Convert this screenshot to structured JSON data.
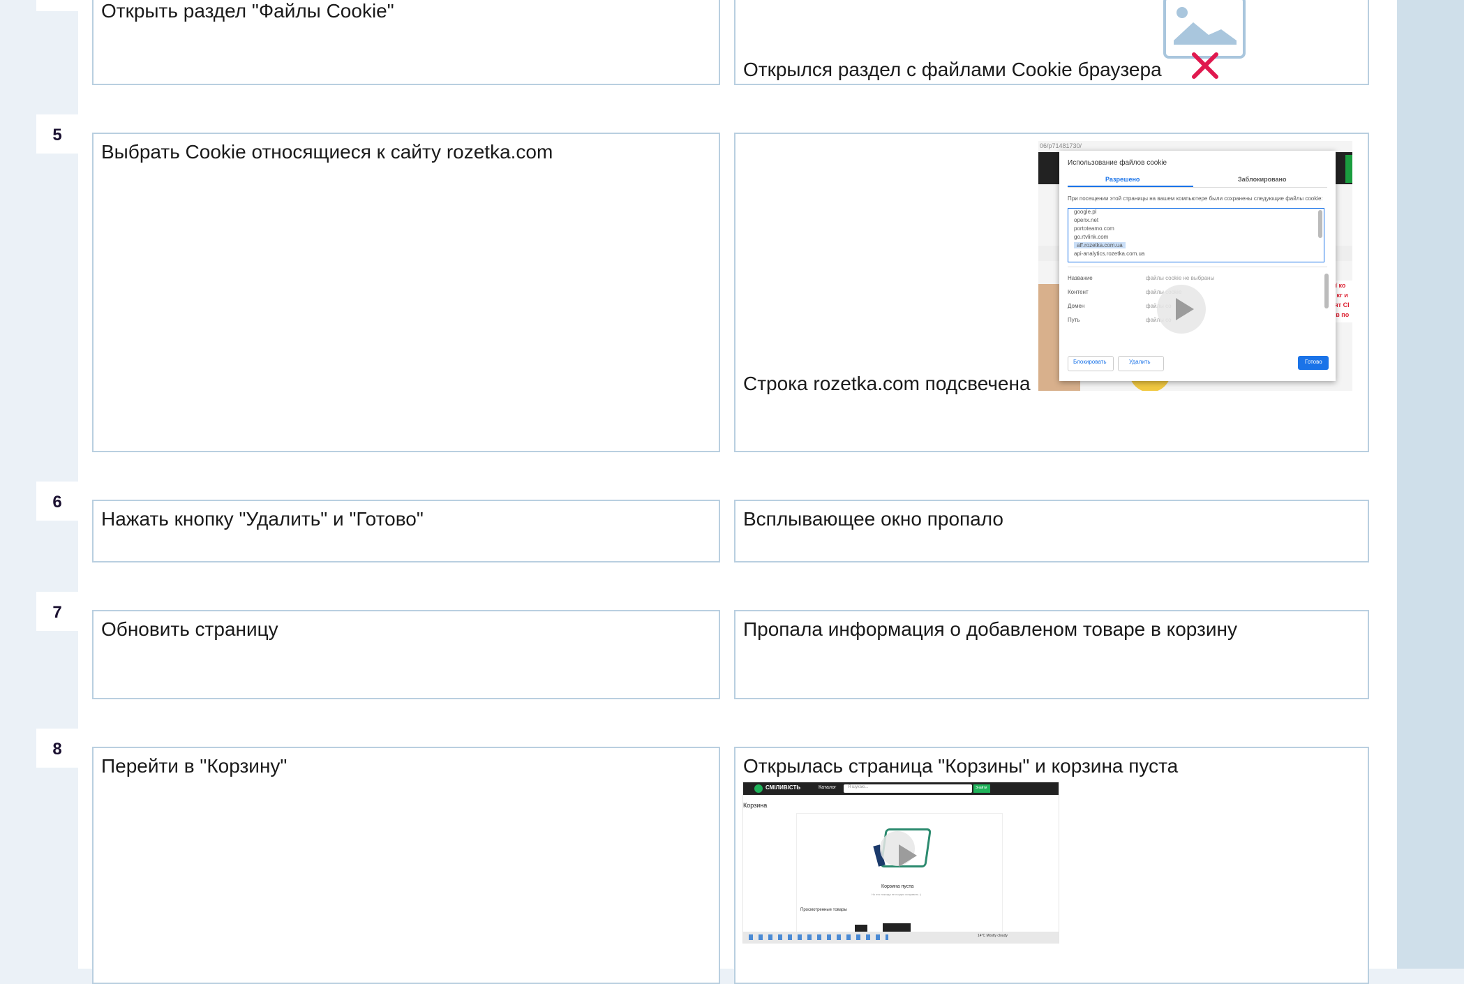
{
  "rows": [
    {
      "num": "",
      "step": "Открыть раздел \"Файлы Cookie\"",
      "result": "Открылся раздел с файлами Cookie браузера"
    },
    {
      "num": "5",
      "step": "Выбрать Cookie относящиеся к сайту rozetka.com",
      "result": "Строка rozetka.com подсвечена"
    },
    {
      "num": "6",
      "step": "Нажать кнопку \"Удалить\" и \"Готово\"",
      "result": "Всплывающее окно пропало"
    },
    {
      "num": "7",
      "step": "Обновить страницу",
      "result": "Пропала информация о добавленом товаре в корзину"
    },
    {
      "num": "8",
      "step": "Перейти в \"Корзину\"",
      "result": "Открылась страница \"Корзины\" и корзина пуста"
    }
  ],
  "cookie_dialog": {
    "url": "06/p71481730/",
    "title": "Использование файлов cookie",
    "tab_allowed": "Разрешено",
    "tab_blocked": "Заблокировано",
    "hint": "При посещении этой страницы на вашем компьютере были сохранены следующие файлы cookie:",
    "sites": [
      "google.pl",
      "openx.net",
      "portoteamo.com",
      "go.rtvlink.com",
      "aff.rozetka.com.ua",
      "api-analytics.rozetka.com.ua"
    ],
    "fields": [
      {
        "label": "Название",
        "value": "файлы cookie не выбраны"
      },
      {
        "label": "Контент",
        "value": "файлы cookie"
      },
      {
        "label": "Домен",
        "value": "файлы co"
      },
      {
        "label": "Путь",
        "value": "файлы co"
      }
    ],
    "btn_block": "Блокировать",
    "btn_delete": "Удалить",
    "btn_done": "Готово"
  },
  "cart_shot": {
    "brand": "СМІЛИВІСТЬ",
    "catalog": "Каталог",
    "search_placeholder": "Я шукаю...",
    "search_btn": "Знайти",
    "page_title": "Корзина",
    "empty": "Корзина пуста",
    "empty_sub": "Но это никогда не поздно исправить :)",
    "viewed": "Просмотренные товары",
    "tray_text": "14°C Mostly cloudy"
  },
  "colors": {
    "border": "#b9cfe0",
    "page_bg": "#ebf1f7",
    "strip": "#cfdfea",
    "broken_red": "#e0194f",
    "broken_blue": "#a9c6dd"
  }
}
